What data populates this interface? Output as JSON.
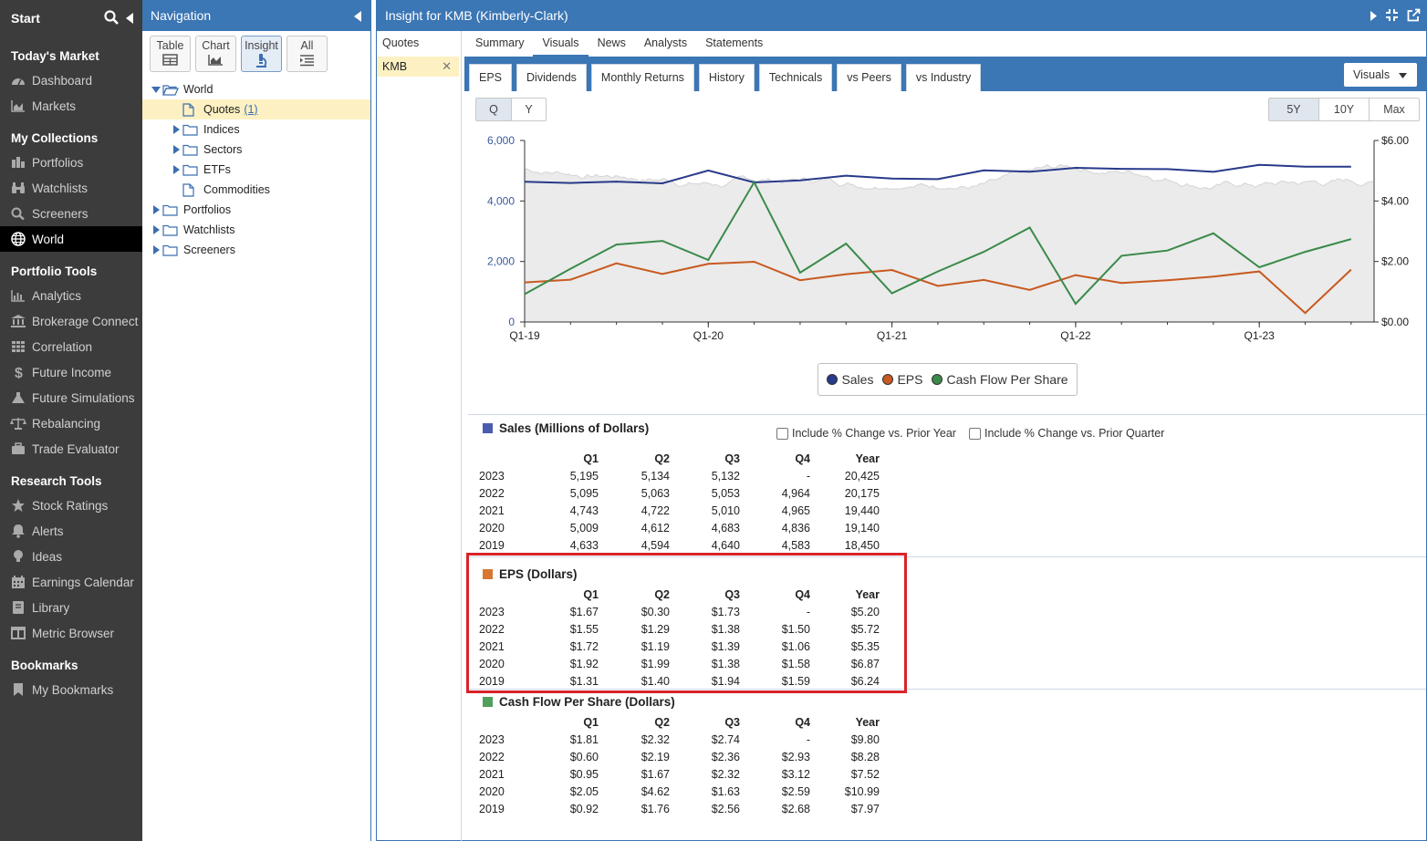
{
  "sidebar": {
    "start_label": "Start",
    "sections": [
      {
        "title": "Today's Market",
        "items": [
          {
            "label": "Dashboard",
            "icon": "dashboard-icon"
          },
          {
            "label": "Markets",
            "icon": "area-chart-icon"
          }
        ]
      },
      {
        "title": "My Collections",
        "items": [
          {
            "label": "Portfolios",
            "icon": "portfolio-icon"
          },
          {
            "label": "Watchlists",
            "icon": "binoculars-icon"
          },
          {
            "label": "Screeners",
            "icon": "search-icon"
          },
          {
            "label": "World",
            "icon": "globe-icon",
            "active": true
          }
        ]
      },
      {
        "title": "Portfolio Tools",
        "items": [
          {
            "label": "Analytics",
            "icon": "bar-chart-icon"
          },
          {
            "label": "Brokerage Connect",
            "icon": "bank-icon"
          },
          {
            "label": "Correlation",
            "icon": "grid-icon"
          },
          {
            "label": "Future Income",
            "icon": "dollar-icon"
          },
          {
            "label": "Future Simulations",
            "icon": "flask-icon"
          },
          {
            "label": "Rebalancing",
            "icon": "balance-scale-icon"
          },
          {
            "label": "Trade Evaluator",
            "icon": "briefcase-icon"
          }
        ]
      },
      {
        "title": "Research Tools",
        "items": [
          {
            "label": "Stock Ratings",
            "icon": "star-icon"
          },
          {
            "label": "Alerts",
            "icon": "bell-icon"
          },
          {
            "label": "Ideas",
            "icon": "lightbulb-icon"
          },
          {
            "label": "Earnings Calendar",
            "icon": "calendar-icon"
          },
          {
            "label": "Library",
            "icon": "book-icon"
          },
          {
            "label": "Metric Browser",
            "icon": "columns-icon"
          }
        ]
      },
      {
        "title": "Bookmarks",
        "items": [
          {
            "label": "My Bookmarks",
            "icon": "bookmark-icon"
          }
        ]
      }
    ]
  },
  "navigation": {
    "title": "Navigation",
    "views": [
      {
        "label": "Table",
        "icon": "table-icon"
      },
      {
        "label": "Chart",
        "icon": "area-chart-icon"
      },
      {
        "label": "Insight",
        "icon": "microscope-icon",
        "active": true
      },
      {
        "label": "All",
        "icon": "list-icon"
      }
    ],
    "tree": [
      {
        "label": "World",
        "level": 0,
        "expander": "open",
        "icon": "folder-open-icon"
      },
      {
        "label": "Quotes",
        "count": "(1)",
        "level": 1,
        "expander": "none",
        "icon": "document-icon",
        "selected": true
      },
      {
        "label": "Indices",
        "level": 1,
        "expander": "closed",
        "icon": "folder-icon"
      },
      {
        "label": "Sectors",
        "level": 1,
        "expander": "closed",
        "icon": "folder-icon"
      },
      {
        "label": "ETFs",
        "level": 1,
        "expander": "closed",
        "icon": "folder-icon"
      },
      {
        "label": "Commodities",
        "level": 1,
        "expander": "none",
        "icon": "document-icon"
      },
      {
        "label": "Portfolios",
        "level": 0,
        "expander": "closed",
        "icon": "folder-icon"
      },
      {
        "label": "Watchlists",
        "level": 0,
        "expander": "closed",
        "icon": "folder-icon"
      },
      {
        "label": "Screeners",
        "level": 0,
        "expander": "closed",
        "icon": "folder-icon"
      }
    ]
  },
  "main": {
    "title": "Insight for KMB (Kimberly-Clark)",
    "quotes_header": "Quotes",
    "quote_item": "KMB",
    "subtabs": [
      "Summary",
      "Visuals",
      "News",
      "Analysts",
      "Statements"
    ],
    "active_subtab": "Visuals",
    "visual_tabs": [
      "EPS",
      "Dividends",
      "Monthly Returns",
      "History",
      "Technicals",
      "vs Peers",
      "vs Industry"
    ],
    "visuals_dropdown": "Visuals",
    "period_buttons": [
      "Q",
      "Y"
    ],
    "active_period": "Q",
    "range_buttons": [
      "5Y",
      "10Y",
      "Max"
    ],
    "active_range": "5Y",
    "include_prior_year": "Include % Change vs. Prior Year",
    "include_prior_quarter": "Include % Change vs. Prior Quarter"
  },
  "colors": {
    "accent": "#3b76b5",
    "sales": "#283a8a",
    "eps": "#c8591f",
    "cfps": "#3a8a4a",
    "highlight": "#d8232a"
  },
  "chart_data": {
    "type": "line",
    "x_ticks": [
      "Q1-19",
      "Q1-20",
      "Q1-21",
      "Q1-22",
      "Q1-23"
    ],
    "left_ticks": [
      "6,000",
      "4,000",
      "2,000",
      "0"
    ],
    "right_ticks": [
      "$6.00",
      "$4.00",
      "$2.00",
      "$0.00"
    ],
    "ylim_left": [
      0,
      6000
    ],
    "ylim_right": [
      0,
      6
    ],
    "categories": [
      "Q1-19",
      "Q2-19",
      "Q3-19",
      "Q4-19",
      "Q1-20",
      "Q2-20",
      "Q3-20",
      "Q4-20",
      "Q1-21",
      "Q2-21",
      "Q3-21",
      "Q4-21",
      "Q1-22",
      "Q2-22",
      "Q3-22",
      "Q4-22",
      "Q1-23",
      "Q2-23",
      "Q3-23"
    ],
    "series": [
      {
        "name": "Sales",
        "axis": "left",
        "values": [
          4633,
          4594,
          4640,
          4583,
          5009,
          4612,
          4683,
          4836,
          4743,
          4722,
          5010,
          4965,
          5095,
          5063,
          5053,
          4964,
          5195,
          5134,
          5132
        ]
      },
      {
        "name": "EPS",
        "axis": "right",
        "values": [
          1.31,
          1.4,
          1.94,
          1.59,
          1.92,
          1.99,
          1.38,
          1.58,
          1.72,
          1.19,
          1.39,
          1.06,
          1.55,
          1.29,
          1.38,
          1.5,
          1.67,
          0.3,
          1.73
        ]
      },
      {
        "name": "Cash Flow Per Share",
        "axis": "right",
        "values": [
          0.92,
          1.76,
          2.56,
          2.68,
          2.05,
          4.62,
          1.63,
          2.59,
          0.95,
          1.67,
          2.32,
          3.12,
          0.6,
          2.19,
          2.36,
          2.93,
          1.81,
          2.32,
          2.74
        ]
      }
    ],
    "legend": [
      "Sales",
      "EPS",
      "Cash Flow Per Share"
    ]
  },
  "tables": [
    {
      "title": "Sales (Millions of Dollars)",
      "color": "#4a5bb0",
      "headers": [
        "",
        "Q1",
        "Q2",
        "Q3",
        "Q4",
        "Year"
      ],
      "rows": [
        [
          "2023",
          "5,195",
          "5,134",
          "5,132",
          "-",
          "20,425"
        ],
        [
          "2022",
          "5,095",
          "5,063",
          "5,053",
          "4,964",
          "20,175"
        ],
        [
          "2021",
          "4,743",
          "4,722",
          "5,010",
          "4,965",
          "19,440"
        ],
        [
          "2020",
          "5,009",
          "4,612",
          "4,683",
          "4,836",
          "19,140"
        ],
        [
          "2019",
          "4,633",
          "4,594",
          "4,640",
          "4,583",
          "18,450"
        ]
      ]
    },
    {
      "title": "EPS (Dollars)",
      "color": "#d8772f",
      "headers": [
        "",
        "Q1",
        "Q2",
        "Q3",
        "Q4",
        "Year"
      ],
      "rows": [
        [
          "2023",
          "$1.67",
          "$0.30",
          "$1.73",
          "-",
          "$5.20"
        ],
        [
          "2022",
          "$1.55",
          "$1.29",
          "$1.38",
          "$1.50",
          "$5.72"
        ],
        [
          "2021",
          "$1.72",
          "$1.19",
          "$1.39",
          "$1.06",
          "$5.35"
        ],
        [
          "2020",
          "$1.92",
          "$1.99",
          "$1.38",
          "$1.58",
          "$6.87"
        ],
        [
          "2019",
          "$1.31",
          "$1.40",
          "$1.94",
          "$1.59",
          "$6.24"
        ]
      ]
    },
    {
      "title": "Cash Flow Per Share (Dollars)",
      "color": "#4ea05a",
      "headers": [
        "",
        "Q1",
        "Q2",
        "Q3",
        "Q4",
        "Year"
      ],
      "rows": [
        [
          "2023",
          "$1.81",
          "$2.32",
          "$2.74",
          "-",
          "$9.80"
        ],
        [
          "2022",
          "$0.60",
          "$2.19",
          "$2.36",
          "$2.93",
          "$8.28"
        ],
        [
          "2021",
          "$0.95",
          "$1.67",
          "$2.32",
          "$3.12",
          "$7.52"
        ],
        [
          "2020",
          "$2.05",
          "$4.62",
          "$1.63",
          "$2.59",
          "$10.99"
        ],
        [
          "2019",
          "$0.92",
          "$1.76",
          "$2.56",
          "$2.68",
          "$7.97"
        ]
      ]
    }
  ]
}
